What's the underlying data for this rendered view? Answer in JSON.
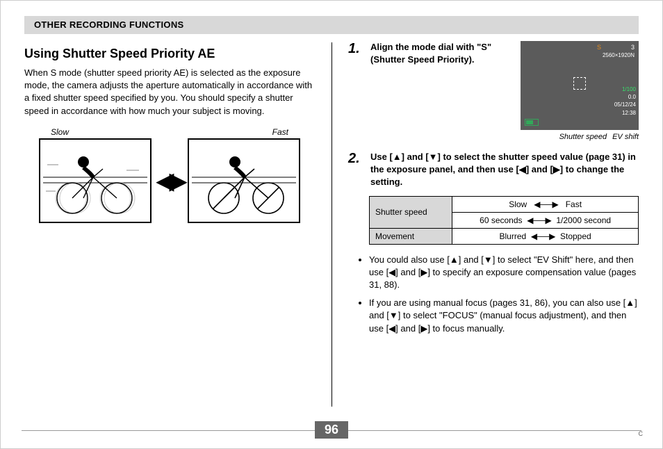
{
  "header": "OTHER RECORDING FUNCTIONS",
  "left": {
    "title": "Using Shutter Speed Priority AE",
    "intro": "When S mode (shutter speed priority AE) is selected as the exposure mode, the camera adjusts the aperture automatically in accordance with a fixed shutter speed specified by you.  You should specify a shutter speed in accordance with how much your subject is moving.",
    "label_slow": "Slow",
    "label_fast": "Fast"
  },
  "right": {
    "step1": {
      "num": "1.",
      "text": "Align the mode dial with \"S\" (Shutter Speed Priority).",
      "screen": {
        "mode": "S",
        "count": "3",
        "resolution": "2560×1920N",
        "shutter": "1/100",
        "ev": "0.0",
        "date": "05/12/24",
        "time": "12:38"
      },
      "callout_left": "Shutter speed",
      "callout_right": "EV shift"
    },
    "step2": {
      "num": "2.",
      "text": "Use [▲] and [▼] to select the shutter speed value (page 31) in the exposure panel, and then use [◀] and [▶] to change the setting."
    },
    "table": {
      "r1": "Shutter speed",
      "r1a": "Slow",
      "r1b": "Fast",
      "r1c": "60 seconds",
      "r1d": "1/2000 second",
      "r2": "Movement",
      "r2a": "Blurred",
      "r2b": "Stopped"
    },
    "bullet1": "You could also use [▲] and [▼] to select \"EV Shift\" here, and then use [◀] and [▶] to specify an exposure compensation value (pages 31, 88).",
    "bullet2": "If you are using manual focus (pages 31, 86), you can also use [▲] and [▼] to select \"FOCUS\" (manual focus adjustment), and then use [◀] and [▶] to focus manually."
  },
  "page_number": "96",
  "corner": "C"
}
